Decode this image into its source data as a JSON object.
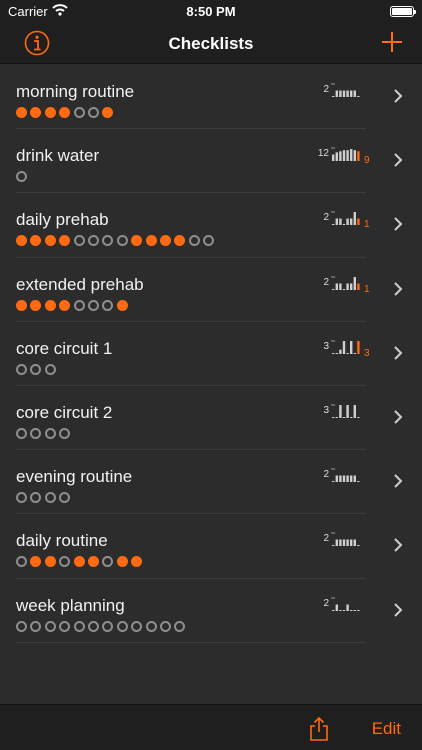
{
  "status_bar": {
    "carrier": "Carrier",
    "time": "8:50 PM",
    "battery_level": 1.0,
    "wifi_icon": "wifi-icon"
  },
  "nav": {
    "title": "Checklists",
    "info_icon": "info-icon",
    "add_icon": "plus-icon"
  },
  "colors": {
    "accent": "#ff6a13",
    "background": "#2c2c2c",
    "bar": "#1f1f1f",
    "empty_dot": "#8e8e8e",
    "spark": "#d0d0d0"
  },
  "checklists": [
    {
      "name": "morning routine",
      "dots": [
        1,
        1,
        1,
        1,
        0,
        0,
        1
      ],
      "spark_max": "2",
      "spark_values": [
        0,
        1,
        1,
        1,
        1,
        1,
        1,
        0
      ],
      "spark_count": ""
    },
    {
      "name": "drink water",
      "dots": [
        0
      ],
      "spark_max": "12",
      "spark_values": [
        6,
        8,
        9,
        10,
        10,
        11,
        10,
        9
      ],
      "spark_count": "9"
    },
    {
      "name": "daily prehab",
      "dots": [
        1,
        1,
        1,
        1,
        0,
        0,
        0,
        0,
        1,
        1,
        1,
        1,
        0,
        0
      ],
      "spark_max": "2",
      "spark_values": [
        0,
        1,
        1,
        0,
        1,
        1,
        2,
        1
      ],
      "spark_count": "1"
    },
    {
      "name": "extended prehab",
      "dots": [
        1,
        1,
        1,
        1,
        0,
        0,
        0,
        1
      ],
      "spark_max": "2",
      "spark_values": [
        0,
        1,
        1,
        0,
        1,
        1,
        2,
        1
      ],
      "spark_count": "1"
    },
    {
      "name": "core circuit 1",
      "dots": [
        0,
        0,
        0
      ],
      "spark_max": "3",
      "spark_values": [
        0,
        0,
        1,
        3,
        0,
        3,
        0,
        3
      ],
      "spark_count": "3"
    },
    {
      "name": "core circuit 2",
      "dots": [
        0,
        0,
        0,
        0
      ],
      "spark_max": "3",
      "spark_values": [
        0,
        0,
        3,
        0,
        3,
        0,
        3,
        0
      ],
      "spark_count": ""
    },
    {
      "name": "evening routine",
      "dots": [
        0,
        0,
        0,
        0
      ],
      "spark_max": "2",
      "spark_values": [
        0,
        1,
        1,
        1,
        1,
        1,
        1,
        0
      ],
      "spark_count": ""
    },
    {
      "name": "daily routine",
      "dots": [
        0,
        1,
        1,
        0,
        1,
        1,
        0,
        1,
        1
      ],
      "spark_max": "2",
      "spark_values": [
        0,
        1,
        1,
        1,
        1,
        1,
        1,
        0
      ],
      "spark_count": ""
    },
    {
      "name": "week planning",
      "dots": [
        0,
        0,
        0,
        0,
        0,
        0,
        0,
        0,
        0,
        0,
        0,
        0
      ],
      "spark_max": "2",
      "spark_values": [
        0,
        1,
        0,
        0,
        1,
        0,
        0,
        0
      ],
      "spark_count": ""
    }
  ],
  "toolbar": {
    "share_icon": "share-icon",
    "edit_label": "Edit"
  }
}
